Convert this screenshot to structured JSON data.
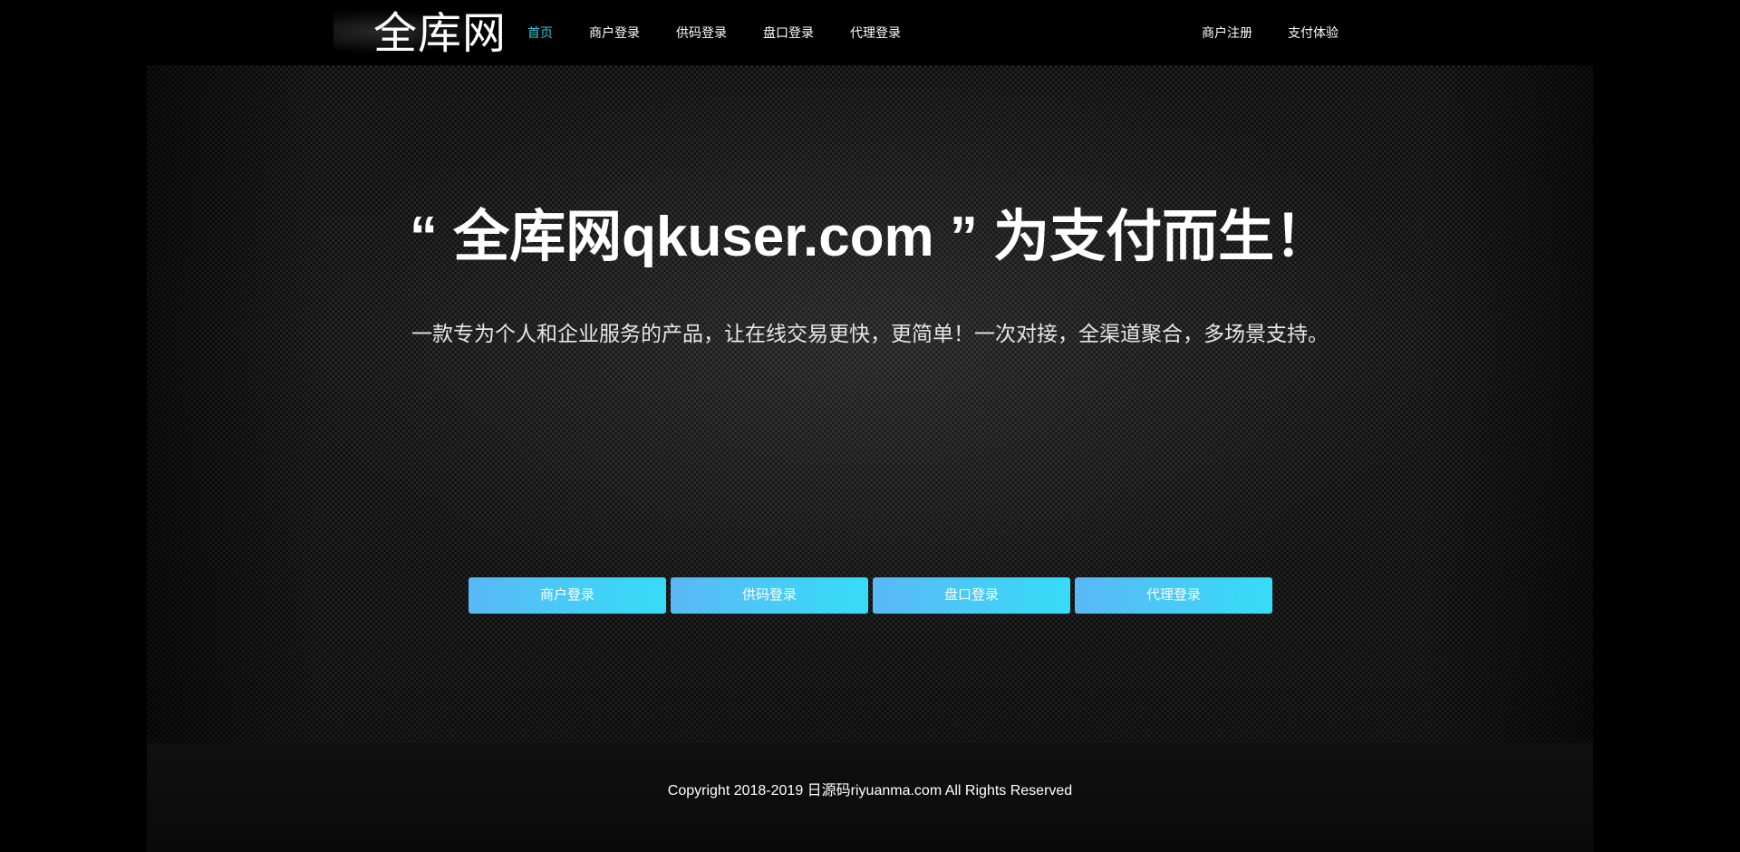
{
  "header": {
    "logo_text": "全库网",
    "nav_left": [
      {
        "label": "首页",
        "active": true
      },
      {
        "label": "商户登录",
        "active": false
      },
      {
        "label": "供码登录",
        "active": false
      },
      {
        "label": "盘口登录",
        "active": false
      },
      {
        "label": "代理登录",
        "active": false
      }
    ],
    "nav_right": [
      {
        "label": "商户注册"
      },
      {
        "label": "支付体验"
      }
    ],
    "active_color": "#2fc7d9"
  },
  "hero": {
    "headline": "“ 全库网qkuser.com ” 为支付而生！",
    "subline": "一款专为个人和企业服务的产品，让在线交易更快，更简单！一次对接，全渠道聚合，多场景支持。",
    "buttons": [
      {
        "label": "商户登录"
      },
      {
        "label": "供码登录"
      },
      {
        "label": "盘口登录"
      },
      {
        "label": "代理登录"
      }
    ],
    "button_gradient": [
      "#5ab8f5",
      "#36dcf7"
    ]
  },
  "footer": {
    "copyright": "Copyright 2018-2019 日源码riyuanma.com All Rights Reserved"
  }
}
